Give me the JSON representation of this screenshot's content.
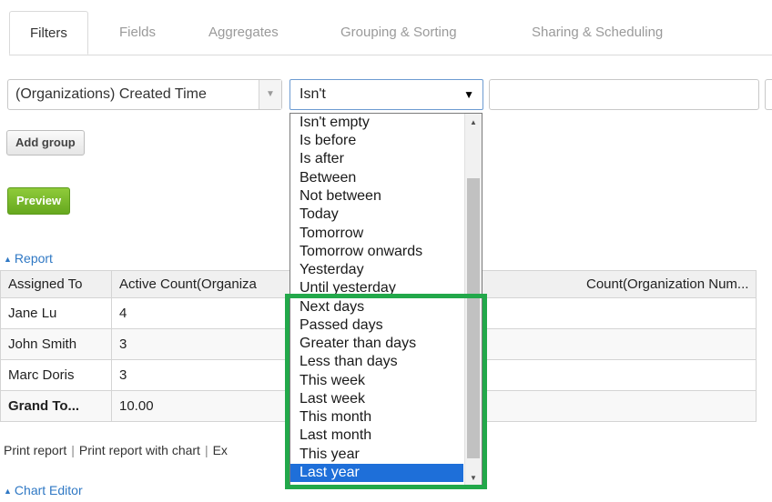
{
  "tabs": [
    {
      "label": "Filters",
      "active": true
    },
    {
      "label": "Fields",
      "active": false
    },
    {
      "label": "Aggregates",
      "active": false
    },
    {
      "label": "Grouping & Sorting",
      "active": false
    },
    {
      "label": "Sharing & Scheduling",
      "active": false
    }
  ],
  "filter": {
    "field_value": "(Organizations) Created Time",
    "operator_value": "Isn't",
    "value_input": ""
  },
  "buttons": {
    "add_group": "Add group",
    "preview": "Preview"
  },
  "report": {
    "section_label": "Report",
    "headers": [
      "Assigned To",
      "Active Count(Organiza",
      "Count(Organization Num..."
    ],
    "rows": [
      {
        "assigned": "Jane Lu",
        "active": "4"
      },
      {
        "assigned": "John Smith",
        "active": "3"
      },
      {
        "assigned": "Marc Doris",
        "active": "3"
      }
    ],
    "total": {
      "label": "Grand To...",
      "value": "10.00"
    }
  },
  "print_links": [
    "Print report",
    "Print report with chart",
    "Ex"
  ],
  "chart_editor_label": "Chart Editor",
  "dropdown_options": [
    "Isn't empty",
    "Is before",
    "Is after",
    "Between",
    "Not between",
    "Today",
    "Tomorrow",
    "Tomorrow onwards",
    "Yesterday",
    "Until yesterday",
    "Next days",
    "Passed days",
    "Greater than days",
    "Less than days",
    "This week",
    "Last week",
    "This month",
    "Last month",
    "This year",
    "Last year"
  ],
  "dropdown_selected": "Last year",
  "colors": {
    "highlight": "#22a84a",
    "selected": "#1e6fd9",
    "preview": "#7aba2d",
    "link": "#2f78c4"
  },
  "icons": {
    "select_arrow": "chevron-down-icon",
    "section_toggle": "triangle-up-icon",
    "scroll_up": "scroll-up-arrow-icon",
    "scroll_down": "scroll-down-arrow-icon"
  }
}
